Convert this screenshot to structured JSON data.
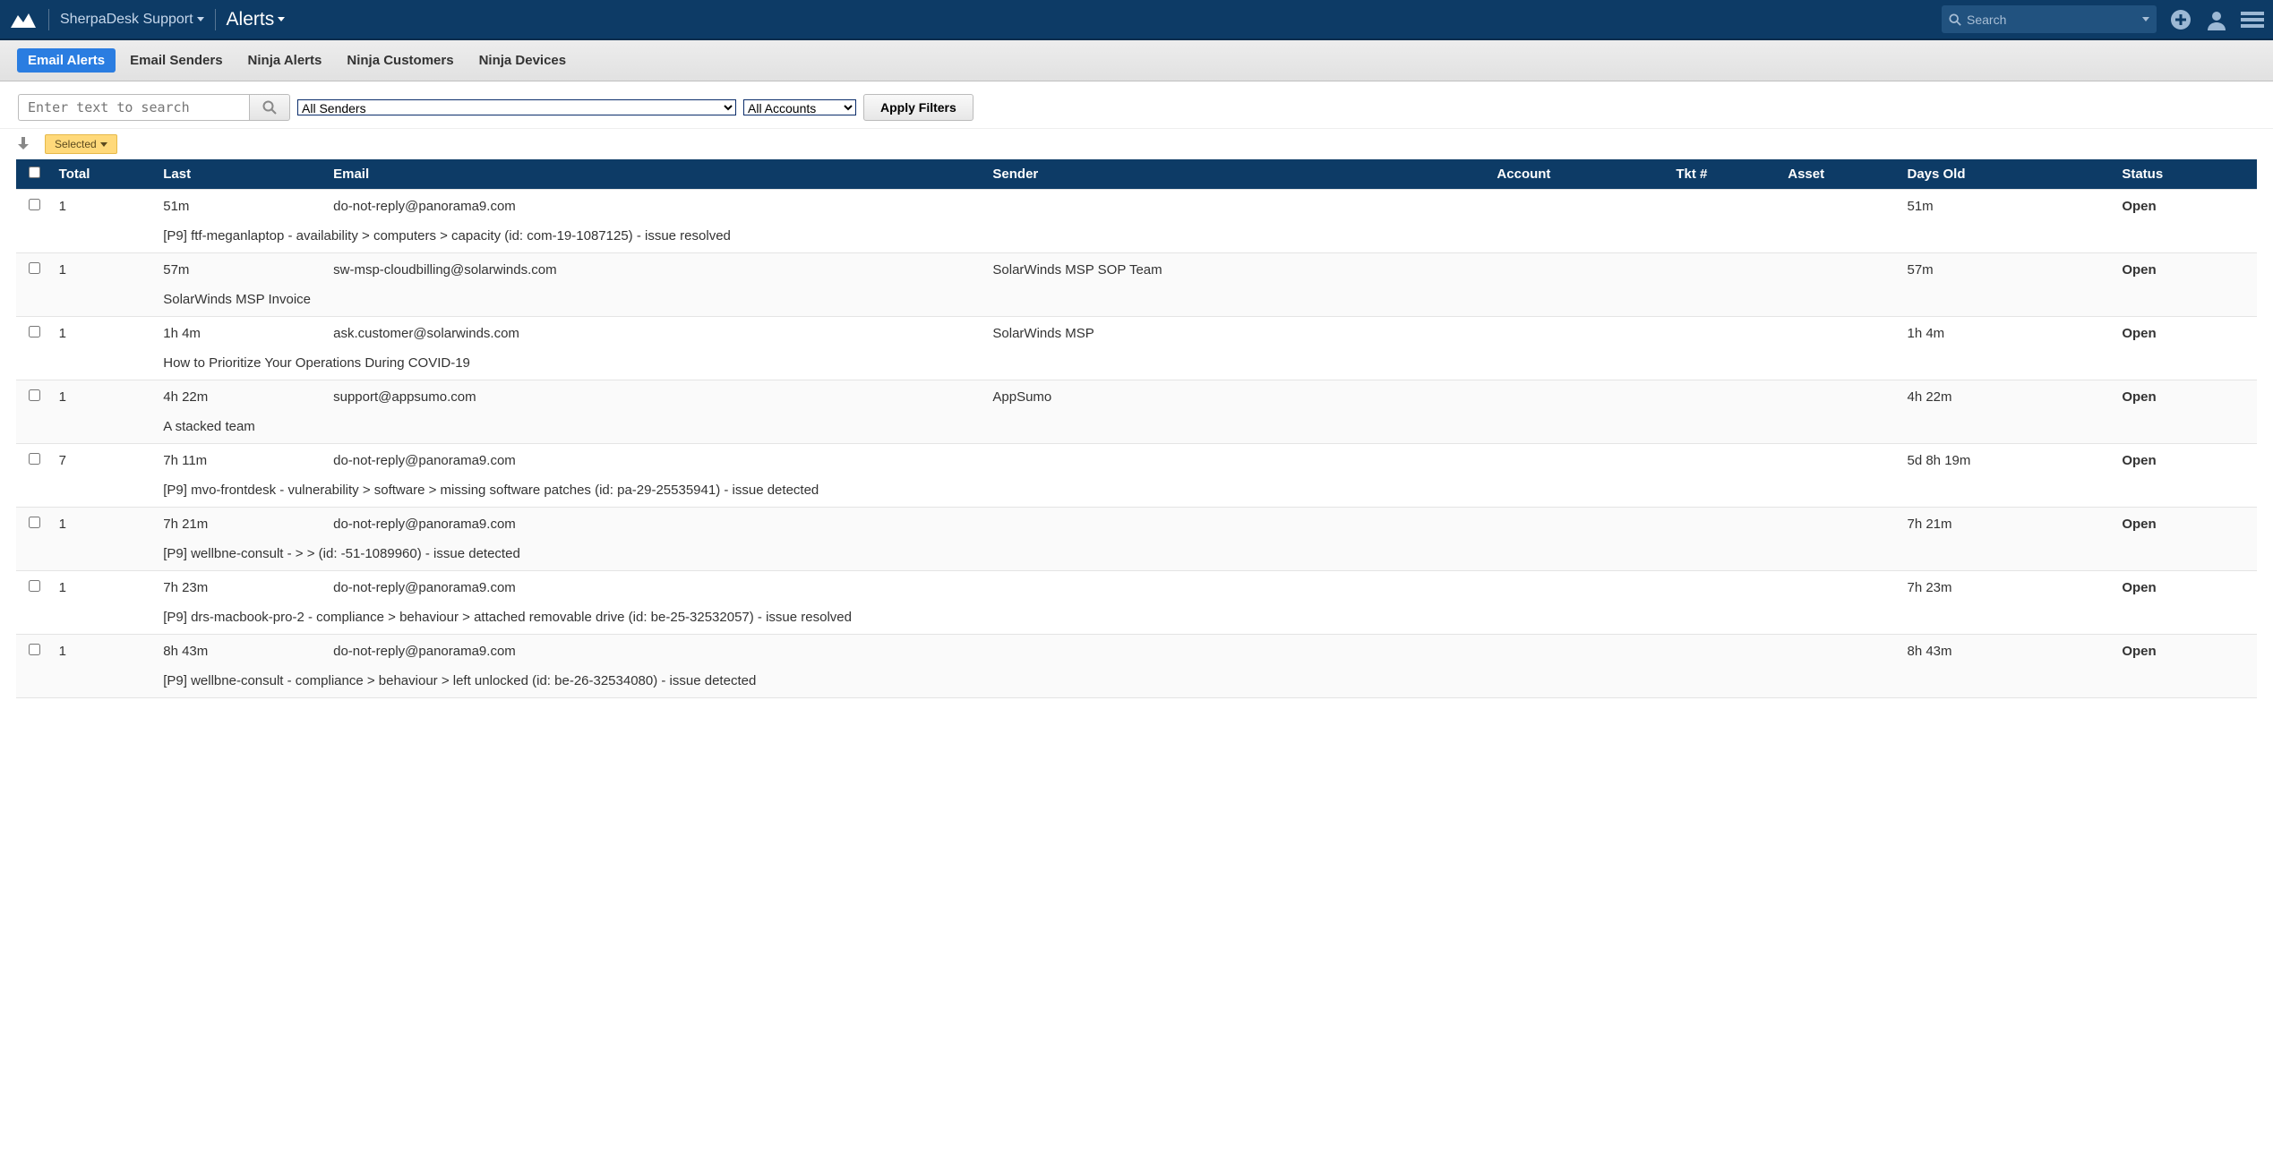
{
  "nav": {
    "org": "SherpaDesk Support",
    "title": "Alerts",
    "search_placeholder": "Search"
  },
  "tabs": [
    {
      "label": "Email Alerts",
      "active": true
    },
    {
      "label": "Email Senders",
      "active": false
    },
    {
      "label": "Ninja Alerts",
      "active": false
    },
    {
      "label": "Ninja Customers",
      "active": false
    },
    {
      "label": "Ninja Devices",
      "active": false
    }
  ],
  "filters": {
    "search_placeholder": "Enter text to search",
    "senders": "All Senders",
    "accounts": "All Accounts",
    "apply": "Apply Filters"
  },
  "selected_label": "Selected",
  "columns": {
    "total": "Total",
    "last": "Last",
    "email": "Email",
    "sender": "Sender",
    "account": "Account",
    "tkt": "Tkt #",
    "asset": "Asset",
    "days": "Days Old",
    "status": "Status"
  },
  "rows": [
    {
      "total": "1",
      "last": "51m",
      "email": "do-not-reply@panorama9.com",
      "sender": "",
      "account": "",
      "tkt": "",
      "asset": "",
      "days": "51m",
      "status": "Open",
      "subject": "[P9] ftf-meganlaptop - availability > computers > capacity (id: com-19-1087125) - issue resolved"
    },
    {
      "total": "1",
      "last": "57m",
      "email": "sw-msp-cloudbilling@solarwinds.com",
      "sender": "SolarWinds MSP SOP Team",
      "account": "",
      "tkt": "",
      "asset": "",
      "days": "57m",
      "status": "Open",
      "subject": "SolarWinds MSP Invoice"
    },
    {
      "total": "1",
      "last": "1h 4m",
      "email": "ask.customer@solarwinds.com",
      "sender": "SolarWinds MSP",
      "account": "",
      "tkt": "",
      "asset": "",
      "days": "1h 4m",
      "status": "Open",
      "subject": "How to Prioritize Your Operations During COVID-19"
    },
    {
      "total": "1",
      "last": "4h 22m",
      "email": "support@appsumo.com",
      "sender": "AppSumo",
      "account": "",
      "tkt": "",
      "asset": "",
      "days": "4h 22m",
      "status": "Open",
      "subject": "A stacked team"
    },
    {
      "total": "7",
      "last": "7h 11m",
      "email": "do-not-reply@panorama9.com",
      "sender": "",
      "account": "",
      "tkt": "",
      "asset": "",
      "days": "5d 8h 19m",
      "status": "Open",
      "subject": "[P9] mvo-frontdesk - vulnerability > software > missing software patches (id: pa-29-25535941) - issue detected"
    },
    {
      "total": "1",
      "last": "7h 21m",
      "email": "do-not-reply@panorama9.com",
      "sender": "",
      "account": "",
      "tkt": "",
      "asset": "",
      "days": "7h 21m",
      "status": "Open",
      "subject": "[P9] wellbne-consult - > > (id: -51-1089960) - issue detected"
    },
    {
      "total": "1",
      "last": "7h 23m",
      "email": "do-not-reply@panorama9.com",
      "sender": "",
      "account": "",
      "tkt": "",
      "asset": "",
      "days": "7h 23m",
      "status": "Open",
      "subject": "[P9] drs-macbook-pro-2 - compliance > behaviour > attached removable drive (id: be-25-32532057) - issue resolved"
    },
    {
      "total": "1",
      "last": "8h 43m",
      "email": "do-not-reply@panorama9.com",
      "sender": "",
      "account": "",
      "tkt": "",
      "asset": "",
      "days": "8h 43m",
      "status": "Open",
      "subject": "[P9] wellbne-consult - compliance > behaviour > left unlocked (id: be-26-32534080) - issue detected"
    }
  ]
}
